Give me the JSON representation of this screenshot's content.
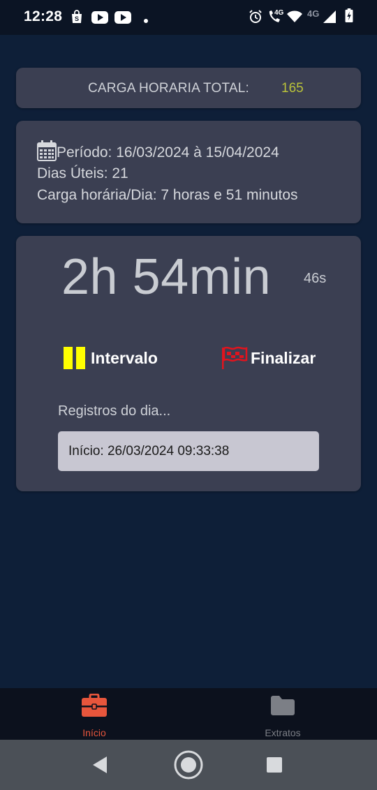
{
  "status_bar": {
    "time": "12:28",
    "network_label": "4G",
    "network_label_2": "4G",
    "left_icons": [
      "shopping-bag-icon",
      "youtube-icon",
      "youtube-icon",
      "notification-dot-icon"
    ],
    "right_icons": [
      "alarm-icon",
      "wifi-call-icon",
      "wifi-icon",
      "signal-icon",
      "battery-charging-icon"
    ]
  },
  "total_card": {
    "label": "CARGA HORARIA TOTAL:",
    "value": "165",
    "value_color": "#b9c23a"
  },
  "periodo_card": {
    "periodo": "Período: 16/03/2024 à 15/04/2024",
    "dias_uteis": "Dias Úteis: 21",
    "carga_dia": "Carga horária/Dia: 7 horas e 51 minutos",
    "icon": "calendar-icon"
  },
  "timer_card": {
    "elapsed": "2h 54min",
    "seconds": "46s",
    "intervalo_label": "Intervalo",
    "intervalo_icon": "pause-icon",
    "intervalo_icon_color": "#ffff00",
    "finalizar_label": "Finalizar",
    "finalizar_icon": "flag-icon",
    "finalizar_icon_color": "#e0141e",
    "registros_label": "Registros do dia...",
    "registros": [
      "Início: 26/03/2024 09:33:38"
    ]
  },
  "bottom_nav": {
    "items": [
      {
        "label": "Início",
        "icon": "briefcase-icon",
        "active": true,
        "color": "#e8563c"
      },
      {
        "label": "Extratos",
        "icon": "folder-icon",
        "active": false,
        "color": "#7c7f86"
      }
    ]
  },
  "system_nav": {
    "buttons": [
      "back-icon",
      "home-icon",
      "recents-icon"
    ]
  }
}
